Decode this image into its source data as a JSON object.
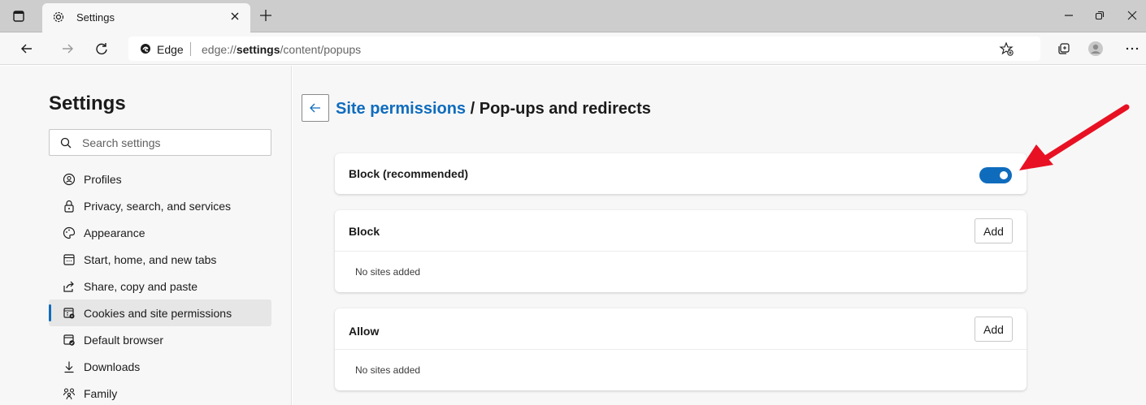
{
  "tab": {
    "title": "Settings"
  },
  "address": {
    "scheme": "Edge",
    "url_prefix": "edge://",
    "url_host": "settings",
    "url_path": "/content/popups"
  },
  "sidebar": {
    "title": "Settings",
    "search_placeholder": "Search settings",
    "items": [
      {
        "label": "Profiles",
        "icon": "profile-icon"
      },
      {
        "label": "Privacy, search, and services",
        "icon": "lock-icon"
      },
      {
        "label": "Appearance",
        "icon": "palette-icon"
      },
      {
        "label": "Start, home, and new tabs",
        "icon": "home-tabs-icon"
      },
      {
        "label": "Share, copy and paste",
        "icon": "share-icon"
      },
      {
        "label": "Cookies and site permissions",
        "icon": "cookies-icon",
        "active": true
      },
      {
        "label": "Default browser",
        "icon": "default-browser-icon"
      },
      {
        "label": "Downloads",
        "icon": "download-icon"
      },
      {
        "label": "Family",
        "icon": "family-icon"
      }
    ]
  },
  "main": {
    "breadcrumb_link": "Site permissions",
    "breadcrumb_sep": " / ",
    "breadcrumb_current": "Pop-ups and redirects",
    "block_recommended": {
      "label": "Block (recommended)",
      "enabled": true
    },
    "block": {
      "label": "Block",
      "add_label": "Add",
      "empty_text": "No sites added"
    },
    "allow": {
      "label": "Allow",
      "add_label": "Add",
      "empty_text": "No sites added"
    }
  },
  "colors": {
    "accent": "#0f6cbd",
    "annotation_arrow": "#e81123"
  }
}
